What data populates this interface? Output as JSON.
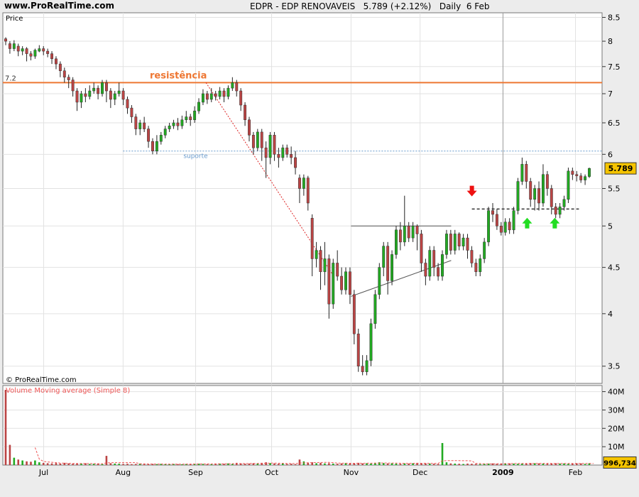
{
  "header": {
    "site": "www.ProRealTime.com",
    "title": "EDPR - EDP RENOVAVEIS",
    "last_change": "5.789 (+2.12%)",
    "period": "Daily  6 Feb"
  },
  "watermark": "© ProRealTime.com",
  "colors": {
    "up": "#22aa22",
    "down": "#bb4444",
    "resistance": "#ee7733",
    "support": "#6699cc",
    "trend": "#dd2222",
    "volume_ma": "#ee5555",
    "badge": "#f5c400"
  },
  "chart_data": [
    {
      "type": "candlestick",
      "ylabel": "Price",
      "ylim": [
        3.35,
        8.6
      ],
      "yscale": "log",
      "yticks": [
        3.5,
        4,
        4.5,
        5,
        5.5,
        6,
        6.5,
        7,
        7.5,
        8,
        8.5
      ],
      "xticks": [
        {
          "label": "Jul",
          "date": "2008-07-01"
        },
        {
          "label": "Aug",
          "date": "2008-08-01"
        },
        {
          "label": "Sep",
          "date": "2008-09-01"
        },
        {
          "label": "Oct",
          "date": "2008-10-01"
        },
        {
          "label": "Nov",
          "date": "2008-11-03"
        },
        {
          "label": "Dec",
          "date": "2008-12-01"
        },
        {
          "label": "2009",
          "date": "2009-01-02"
        },
        {
          "label": "Feb",
          "date": "2009-02-02"
        }
      ],
      "last_value": "5.789",
      "levels": [
        {
          "name": "resistência",
          "value": 7.2,
          "label": "7.2",
          "style": "solid"
        },
        {
          "name": "suporte",
          "value": 6.05,
          "style": "dotted"
        }
      ],
      "annotations": [
        {
          "type": "resistance-label",
          "text": "resistência",
          "at": 7.2
        },
        {
          "type": "support-label",
          "text": "suporte",
          "at": 6.05
        },
        {
          "type": "trendline-dotted",
          "from": {
            "date": "2008-09-04",
            "value": 7.2
          },
          "to": {
            "date": "2008-10-27",
            "value": 4.4
          }
        },
        {
          "type": "box-top",
          "from": {
            "date": "2008-11-03",
            "value": 5.0
          },
          "to": {
            "date": "2008-12-12",
            "value": 5.0
          }
        },
        {
          "type": "trendline",
          "from": {
            "date": "2008-11-03",
            "value": 4.18
          },
          "to": {
            "date": "2008-12-12",
            "value": 4.58
          }
        },
        {
          "type": "neckline-dashed",
          "from": {
            "date": "2008-12-22",
            "value": 5.22
          },
          "to": {
            "date": "2009-02-03",
            "value": 5.22
          }
        },
        {
          "type": "arrow-down",
          "date": "2008-12-22",
          "value": 5.4
        },
        {
          "type": "arrow-up",
          "date": "2009-01-13",
          "value": 5.05
        },
        {
          "type": "arrow-up",
          "date": "2009-01-23",
          "value": 5.05
        }
      ],
      "candles": [
        [
          8.05,
          8.0,
          8.08,
          7.92
        ],
        [
          7.95,
          7.85,
          8.0,
          7.75
        ],
        [
          7.85,
          7.95,
          8.02,
          7.8
        ],
        [
          7.9,
          7.8,
          7.95,
          7.7
        ],
        [
          7.8,
          7.85,
          7.9,
          7.72
        ],
        [
          7.85,
          7.75,
          7.88,
          7.6
        ],
        [
          7.75,
          7.7,
          7.8,
          7.62
        ],
        [
          7.7,
          7.82,
          7.85,
          7.65
        ],
        [
          7.8,
          7.85,
          7.92,
          7.78
        ],
        [
          7.85,
          7.8,
          7.9,
          7.72
        ],
        [
          7.8,
          7.75,
          7.85,
          7.68
        ],
        [
          7.75,
          7.65,
          7.8,
          7.55
        ],
        [
          7.65,
          7.55,
          7.7,
          7.45
        ],
        [
          7.55,
          7.42,
          7.6,
          7.3
        ],
        [
          7.42,
          7.3,
          7.48,
          7.2
        ],
        [
          7.3,
          7.25,
          7.35,
          7.1
        ],
        [
          7.25,
          7.05,
          7.3,
          6.95
        ],
        [
          7.05,
          6.85,
          7.1,
          6.7
        ],
        [
          6.85,
          7.0,
          7.05,
          6.75
        ],
        [
          7.0,
          6.95,
          7.1,
          6.85
        ],
        [
          6.95,
          7.05,
          7.15,
          6.9
        ],
        [
          7.05,
          7.1,
          7.2,
          7.0
        ],
        [
          7.1,
          7.0,
          7.15,
          6.9
        ],
        [
          7.0,
          7.2,
          7.25,
          6.95
        ],
        [
          7.2,
          7.05,
          7.25,
          6.85
        ],
        [
          7.05,
          6.9,
          7.1,
          6.75
        ],
        [
          6.9,
          7.0,
          7.05,
          6.8
        ],
        [
          7.0,
          7.05,
          7.2,
          6.95
        ],
        [
          7.05,
          6.9,
          7.1,
          6.8
        ],
        [
          6.9,
          6.75,
          6.95,
          6.65
        ],
        [
          6.75,
          6.6,
          6.8,
          6.5
        ],
        [
          6.6,
          6.4,
          6.65,
          6.3
        ],
        [
          6.4,
          6.5,
          6.55,
          6.3
        ],
        [
          6.5,
          6.4,
          6.6,
          6.35
        ],
        [
          6.4,
          6.2,
          6.45,
          6.1
        ],
        [
          6.2,
          6.05,
          6.25,
          6.0
        ],
        [
          6.05,
          6.2,
          6.3,
          6.0
        ],
        [
          6.2,
          6.3,
          6.35,
          6.15
        ],
        [
          6.3,
          6.4,
          6.45,
          6.25
        ],
        [
          6.4,
          6.45,
          6.5,
          6.35
        ],
        [
          6.45,
          6.5,
          6.55,
          6.4
        ],
        [
          6.5,
          6.45,
          6.58,
          6.38
        ],
        [
          6.45,
          6.55,
          6.62,
          6.4
        ],
        [
          6.55,
          6.6,
          6.7,
          6.5
        ],
        [
          6.6,
          6.55,
          6.65,
          6.45
        ],
        [
          6.55,
          6.7,
          6.78,
          6.5
        ],
        [
          6.7,
          6.85,
          6.92,
          6.65
        ],
        [
          6.85,
          7.0,
          7.08,
          6.8
        ],
        [
          7.0,
          6.9,
          7.05,
          6.82
        ],
        [
          6.9,
          7.0,
          7.1,
          6.85
        ],
        [
          7.0,
          6.95,
          7.05,
          6.88
        ],
        [
          6.95,
          7.05,
          7.12,
          6.9
        ],
        [
          7.05,
          6.95,
          7.1,
          6.85
        ],
        [
          6.95,
          7.1,
          7.15,
          6.9
        ],
        [
          7.1,
          7.2,
          7.3,
          7.05
        ],
        [
          7.2,
          7.05,
          7.25,
          6.95
        ],
        [
          7.05,
          6.8,
          7.1,
          6.7
        ],
        [
          6.8,
          6.55,
          6.85,
          6.45
        ],
        [
          6.55,
          6.3,
          6.6,
          6.2
        ],
        [
          6.3,
          6.1,
          6.35,
          6.0
        ],
        [
          6.1,
          6.35,
          6.4,
          6.05
        ],
        [
          6.35,
          6.1,
          6.4,
          5.9
        ],
        [
          6.1,
          5.95,
          6.2,
          5.65
        ],
        [
          5.95,
          6.3,
          6.35,
          5.85
        ],
        [
          6.3,
          6.0,
          6.35,
          5.9
        ],
        [
          6.0,
          5.95,
          6.1,
          5.8
        ],
        [
          5.95,
          6.1,
          6.15,
          5.9
        ],
        [
          6.1,
          6.0,
          6.15,
          5.95
        ],
        [
          6.0,
          5.95,
          6.12,
          5.85
        ],
        [
          5.95,
          5.8,
          6.05,
          5.7
        ],
        [
          5.65,
          5.5,
          5.7,
          5.3
        ],
        [
          5.5,
          5.65,
          5.7,
          5.4
        ],
        [
          5.65,
          5.3,
          5.68,
          5.2
        ],
        [
          5.1,
          4.6,
          5.15,
          4.4
        ],
        [
          4.6,
          4.7,
          4.8,
          4.5
        ],
        [
          4.7,
          4.45,
          4.75,
          4.25
        ],
        [
          4.45,
          4.6,
          4.8,
          4.3
        ],
        [
          4.6,
          4.1,
          4.65,
          3.95
        ],
        [
          4.1,
          4.55,
          4.6,
          4.05
        ],
        [
          4.55,
          4.4,
          4.7,
          4.35
        ],
        [
          4.4,
          4.25,
          4.5,
          4.2
        ],
        [
          4.25,
          4.45,
          4.5,
          4.2
        ],
        [
          4.45,
          4.2,
          4.5,
          4.1
        ],
        [
          4.2,
          3.8,
          4.25,
          3.7
        ],
        [
          3.8,
          3.5,
          3.85,
          3.45
        ],
        [
          3.5,
          3.45,
          3.6,
          3.42
        ],
        [
          3.45,
          3.55,
          3.6,
          3.42
        ],
        [
          3.55,
          3.9,
          3.95,
          3.5
        ],
        [
          3.9,
          4.2,
          4.25,
          3.85
        ],
        [
          4.2,
          4.5,
          4.55,
          4.15
        ],
        [
          4.5,
          4.75,
          4.8,
          4.4
        ],
        [
          4.75,
          4.35,
          4.8,
          4.2
        ],
        [
          4.35,
          4.65,
          4.7,
          4.3
        ],
        [
          4.65,
          4.95,
          5.0,
          4.6
        ],
        [
          4.95,
          4.8,
          5.05,
          4.7
        ],
        [
          4.8,
          5.0,
          5.4,
          4.75
        ],
        [
          5.0,
          4.85,
          5.05,
          4.8
        ],
        [
          4.85,
          5.0,
          5.05,
          4.8
        ],
        [
          5.0,
          4.9,
          5.02,
          4.7
        ],
        [
          4.9,
          4.55,
          4.95,
          4.45
        ],
        [
          4.55,
          4.4,
          4.6,
          4.3
        ],
        [
          4.4,
          4.7,
          4.75,
          4.35
        ],
        [
          4.7,
          4.5,
          4.75,
          4.4
        ],
        [
          4.5,
          4.4,
          4.55,
          4.35
        ],
        [
          4.4,
          4.65,
          4.7,
          4.35
        ],
        [
          4.65,
          4.9,
          4.95,
          4.6
        ],
        [
          4.9,
          4.7,
          4.95,
          4.65
        ],
        [
          4.7,
          4.9,
          4.95,
          4.65
        ],
        [
          4.9,
          4.75,
          4.92,
          4.7
        ],
        [
          4.75,
          4.85,
          4.9,
          4.7
        ],
        [
          4.85,
          4.7,
          4.9,
          4.6
        ],
        [
          4.7,
          4.55,
          4.75,
          4.5
        ],
        [
          4.55,
          4.45,
          4.6,
          4.4
        ],
        [
          4.45,
          4.6,
          4.65,
          4.4
        ],
        [
          4.6,
          4.8,
          4.85,
          4.55
        ],
        [
          4.8,
          5.2,
          5.25,
          4.75
        ],
        [
          5.2,
          5.15,
          5.3,
          5.05
        ],
        [
          5.15,
          5.0,
          5.22,
          4.95
        ],
        [
          5.0,
          4.92,
          5.05,
          4.88
        ],
        [
          4.92,
          5.05,
          5.1,
          4.88
        ],
        [
          5.05,
          4.95,
          5.1,
          4.9
        ],
        [
          4.95,
          5.2,
          5.25,
          4.9
        ],
        [
          5.2,
          5.6,
          5.65,
          5.15
        ],
        [
          5.6,
          5.85,
          5.95,
          5.55
        ],
        [
          5.85,
          5.6,
          5.9,
          5.5
        ],
        [
          5.6,
          5.35,
          5.65,
          5.25
        ],
        [
          5.35,
          5.5,
          5.55,
          5.2
        ],
        [
          5.5,
          5.3,
          5.6,
          5.2
        ],
        [
          5.3,
          5.7,
          5.85,
          5.25
        ],
        [
          5.7,
          5.5,
          5.75,
          5.4
        ],
        [
          5.5,
          5.25,
          5.55,
          5.15
        ],
        [
          5.25,
          5.15,
          5.3,
          5.1
        ],
        [
          5.15,
          5.25,
          5.3,
          5.1
        ],
        [
          5.25,
          5.35,
          5.4,
          5.2
        ],
        [
          5.35,
          5.75,
          5.8,
          5.3
        ],
        [
          5.75,
          5.7,
          5.8,
          5.62
        ],
        [
          5.7,
          5.68,
          5.75,
          5.6
        ],
        [
          5.68,
          5.62,
          5.72,
          5.58
        ],
        [
          5.62,
          5.67,
          5.7,
          5.55
        ],
        [
          5.67,
          5.789,
          5.8,
          5.65
        ]
      ]
    },
    {
      "type": "bar",
      "title": "Volume Moving average (Simple 8)",
      "ylim": [
        0,
        41000000
      ],
      "yticks": [
        {
          "label": "10M",
          "value": 10000000
        },
        {
          "label": "20M",
          "value": 20000000
        },
        {
          "label": "30M",
          "value": 30000000
        },
        {
          "label": "40M",
          "value": 40000000
        }
      ],
      "last_value": "996,734",
      "values": [
        41000000,
        11000000,
        4000000,
        3000000,
        2500000,
        2000000,
        1800000,
        2500000,
        1500000,
        1200000,
        1000000,
        900000,
        1100000,
        800000,
        1200000,
        900000,
        700000,
        800000,
        900000,
        1000000,
        600000,
        700000,
        800000,
        500000,
        5000000,
        1000000,
        800000,
        700000,
        600000,
        700000,
        500000,
        600000,
        800000,
        500000,
        400000,
        600000,
        500000,
        700000,
        400000,
        500000,
        600000,
        500000,
        400000,
        600000,
        500000,
        700000,
        800000,
        600000,
        500000,
        400000,
        600000,
        800000,
        700000,
        900000,
        600000,
        1200000,
        900000,
        700000,
        800000,
        1000000,
        900000,
        1200000,
        1500000,
        1100000,
        900000,
        700000,
        800000,
        600000,
        700000,
        500000,
        3000000,
        2000000,
        1200000,
        1500000,
        1000000,
        1200000,
        900000,
        1000000,
        800000,
        700000,
        900000,
        1100000,
        800000,
        1000000,
        1200000,
        900000,
        1000000,
        800000,
        1200000,
        1500000,
        1100000,
        900000,
        1000000,
        800000,
        700000,
        900000,
        800000,
        1000000,
        1200000,
        1000000,
        900000,
        800000,
        700000,
        600000,
        12000000,
        1500000,
        900000,
        800000,
        700000,
        600000,
        800000,
        700000,
        600000,
        500000,
        700000,
        800000,
        900000,
        700000,
        800000,
        1000000,
        900000,
        800000,
        700000,
        800000,
        900000,
        1100000,
        1000000,
        900000,
        800000,
        700000,
        900000,
        1000000,
        800000,
        900000,
        700000,
        800000,
        1000000,
        900000,
        600000,
        996734
      ],
      "ma": [
        null,
        null,
        null,
        null,
        null,
        null,
        null,
        9500000,
        3300000,
        2000000,
        1700000,
        1500000,
        1300000,
        1100000,
        1000000,
        950000,
        900000,
        850000,
        820000,
        850000,
        800000,
        780000,
        720000,
        700000,
        1200000,
        1250000,
        1300000,
        1290000,
        1300000,
        1310000,
        1300000,
        1320000,
        700000,
        650000,
        600000,
        580000,
        560000,
        560000,
        550000,
        520000,
        530000,
        520000,
        510000,
        540000,
        560000,
        580000,
        590000,
        600000,
        610000,
        620000,
        640000,
        680000,
        700000,
        720000,
        730000,
        780000,
        800000,
        830000,
        840000,
        860000,
        900000,
        950000,
        1000000,
        1050000,
        1050000,
        1000000,
        950000,
        900000,
        850000,
        800000,
        1100000,
        1200000,
        1250000,
        1300000,
        1350000,
        1400000,
        1420000,
        1450000,
        1300000,
        1100000,
        1000000,
        1000000,
        950000,
        950000,
        1000000,
        960000,
        1000000,
        1000000,
        1050000,
        1100000,
        1120000,
        1080000,
        1050000,
        1050000,
        1000000,
        980000,
        950000,
        950000,
        970000,
        980000,
        990000,
        960000,
        930000,
        900000,
        2300000,
        2400000,
        2450000,
        2450000,
        2400000,
        2350000,
        2350000,
        2300000,
        900000,
        800000,
        700000,
        680000,
        700000,
        720000,
        740000,
        780000,
        820000,
        850000,
        850000,
        850000,
        860000,
        880000,
        900000,
        920000,
        920000,
        920000,
        900000,
        880000,
        900000,
        880000,
        880000,
        860000,
        850000,
        860000,
        860000,
        850000,
        860000
      ]
    }
  ]
}
